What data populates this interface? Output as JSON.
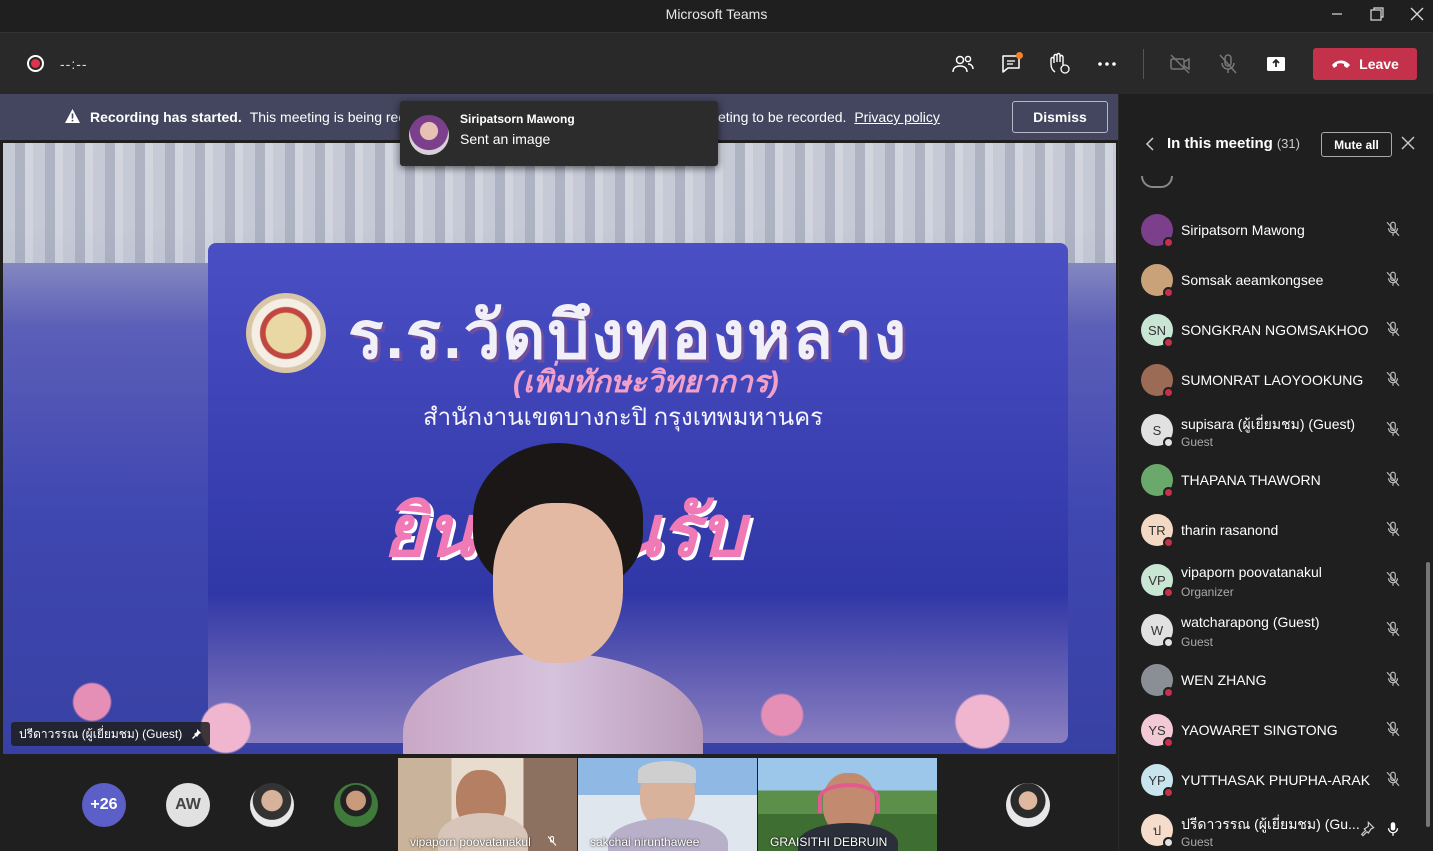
{
  "window": {
    "title": "Microsoft Teams"
  },
  "toolbar": {
    "timer": "--:--",
    "leave_label": "Leave"
  },
  "banner": {
    "title": "Recording has started.",
    "text_start": "This meeting is being rec",
    "text_end": "eting to be recorded.",
    "privacy_label": "Privacy policy",
    "dismiss_label": "Dismiss"
  },
  "toast": {
    "sender": "Siripatsorn Mawong",
    "message": "Sent an image"
  },
  "main_video": {
    "speaker_label": "ปรีดาวรรณ (ผู้เยี่ยมชม) (Guest)",
    "poster_title": "ร.ร.วัดบึงทองหลาง",
    "poster_subtitle": "(เพิ่มทักษะวิทยาการ)",
    "poster_line": "สำนักงานเขตบางกะปิ  กรุงเทพมหานคร",
    "poster_welcome": "ยินดีต้อนรับ"
  },
  "strip": {
    "overflow": "+26",
    "initials": "AW",
    "tiles": [
      {
        "name": "vipaporn poovatanakul"
      },
      {
        "name": "sakchai nirunthawee"
      },
      {
        "name": "GRAISITHI DEBRUIN"
      }
    ]
  },
  "panel": {
    "title": "In this meeting",
    "count": "(31)",
    "mute_all_label": "Mute all",
    "participants": [
      {
        "name": "Siripatsorn Mawong",
        "role": "",
        "initials": "",
        "avatar_color": "#7b3f8c",
        "status": "#c4314b"
      },
      {
        "name": "Somsak aeamkongsee",
        "role": "",
        "initials": "",
        "avatar_color": "#c9a27a",
        "status": "#c4314b"
      },
      {
        "name": "SONGKRAN NGOMSAKHOO",
        "role": "",
        "initials": "SN",
        "avatar_color": "#c8e6d3",
        "status": "#c4314b"
      },
      {
        "name": "SUMONRAT LAOYOOKUNG",
        "role": "",
        "initials": "",
        "avatar_color": "#9b6b55",
        "status": "#c4314b"
      },
      {
        "name": "supisara (ผู้เยี่ยมชม) (Guest)",
        "role": "Guest",
        "initials": "S",
        "avatar_color": "#e1e1e1",
        "status": "#e1e1e1"
      },
      {
        "name": "THAPANA THAWORN",
        "role": "",
        "initials": "",
        "avatar_color": "#6aa86b",
        "status": "#c4314b"
      },
      {
        "name": "tharin rasanond",
        "role": "",
        "initials": "TR",
        "avatar_color": "#f3d9c3",
        "status": "#c4314b"
      },
      {
        "name": "vipaporn poovatanakul",
        "role": "Organizer",
        "initials": "VP",
        "avatar_color": "#c8e6d3",
        "status": "#c4314b"
      },
      {
        "name": "watcharapong (Guest)",
        "role": "Guest",
        "initials": "W",
        "avatar_color": "#e1e1e1",
        "status": "#e1e1e1"
      },
      {
        "name": "WEN ZHANG",
        "role": "",
        "initials": "",
        "avatar_color": "#8a8f96",
        "status": "#c4314b"
      },
      {
        "name": "YAOWARET SINGTONG",
        "role": "",
        "initials": "YS",
        "avatar_color": "#f3c9d6",
        "status": "#c4314b"
      },
      {
        "name": "YUTTHASAK PHUPHA-ARAK",
        "role": "",
        "initials": "YP",
        "avatar_color": "#c7e4ef",
        "status": "#c4314b"
      },
      {
        "name": "ปรีดาวรรณ (ผู้เยี่ยมชม) (Gu...",
        "role": "Guest",
        "initials": "ป",
        "avatar_color": "#f6dccb",
        "status": "#e1e1e1"
      }
    ]
  },
  "colors": {
    "leave": "#c4314b",
    "banner": "#44455e",
    "accent": "#a6a7dc"
  }
}
